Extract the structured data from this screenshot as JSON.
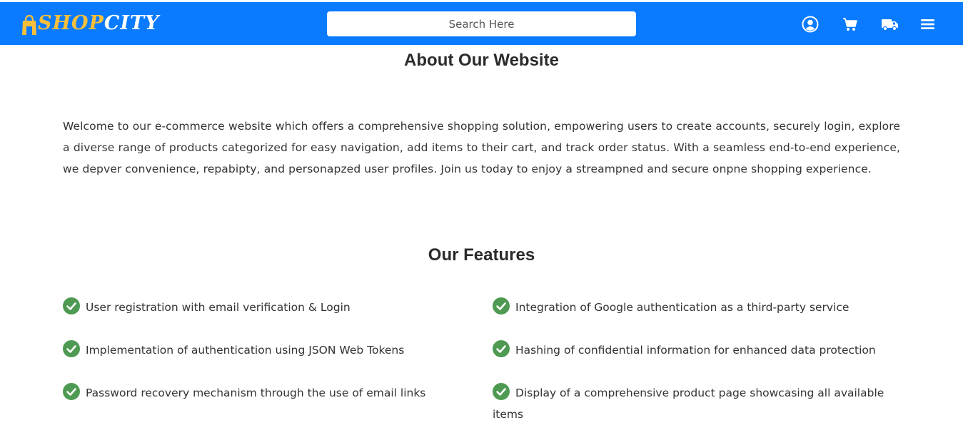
{
  "header": {
    "logo_text_shop": "SHOP",
    "logo_text_city": "CITY",
    "search_placeholder": "Search Here",
    "icons": [
      "user-circle-icon",
      "cart-icon",
      "truck-icon",
      "menu-icon"
    ]
  },
  "about": {
    "title": "About Our Website",
    "paragraph": "Welcome to our e-commerce website which offers a comprehensive shopping solution, empowering users to create accounts, securely login, explore a diverse range of products categorized for easy navigation, add items to their cart, and track order status. With a seamless end-to-end experience, we depver convenience, repabipty, and personapzed user profiles. Join us today to enjoy a streampned and secure onpne shopping experience."
  },
  "features": {
    "title": "Our Features",
    "items": [
      "User registration with email verification & Login",
      "Integration of Google authentication as a third-party service",
      "Implementation of authentication using JSON Web Tokens",
      "Hashing of confidential information for enhanced data protection",
      "Password recovery mechanism through the use of email links",
      "Display of a comprehensive product page showcasing all available items"
    ]
  },
  "colors": {
    "navbar": "#0a7bff",
    "logo_accent": "#f7bf3a",
    "check_green": "#4e9a52"
  }
}
